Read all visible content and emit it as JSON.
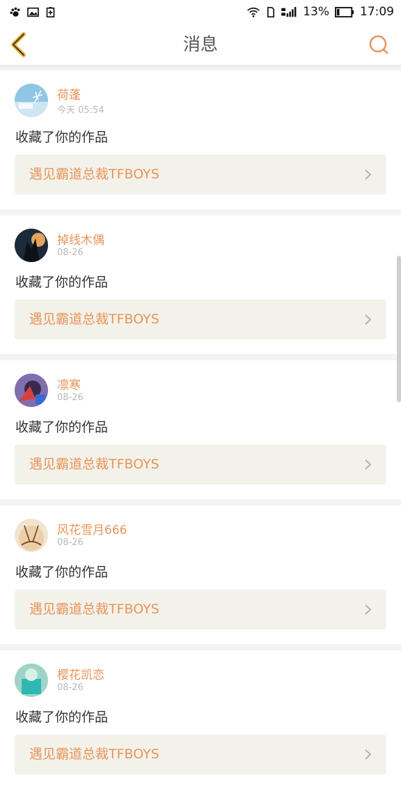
{
  "status_bar": {
    "battery": "13%",
    "time": "17:09",
    "left_icons": [
      "paw-icon",
      "image-icon",
      "battery-saver-icon"
    ],
    "right_icons": [
      "wifi-icon",
      "sim-icon",
      "4g-signal-icon"
    ]
  },
  "nav": {
    "title": "消息",
    "accent_color": "#e8945a"
  },
  "messages": [
    {
      "user": "荷蓬",
      "time": "今天 05:54",
      "action": "收藏了你的作品",
      "work": "遇见霸道总裁TFBOYS"
    },
    {
      "user": "掉线木偶",
      "time": "08-26",
      "action": "收藏了你的作品",
      "work": "遇见霸道总裁TFBOYS"
    },
    {
      "user": "凛寒",
      "time": "08-26",
      "action": "收藏了你的作品",
      "work": "遇见霸道总裁TFBOYS"
    },
    {
      "user": "风花雪月666",
      "time": "08-26",
      "action": "收藏了你的作品",
      "work": "遇见霸道总裁TFBOYS"
    },
    {
      "user": "樱花凯恋",
      "time": "08-26",
      "action": "收藏了你的作品",
      "work": "遇见霸道总裁TFBOYS"
    }
  ]
}
